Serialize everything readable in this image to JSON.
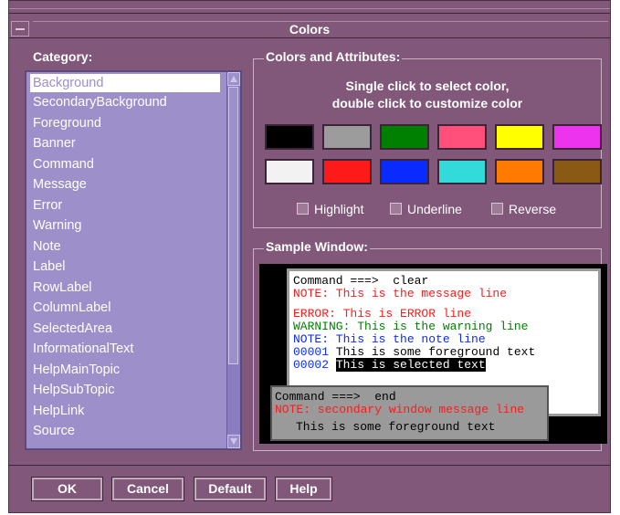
{
  "window": {
    "title": "Colors"
  },
  "category": {
    "label": "Category:",
    "items": [
      "Background",
      "SecondaryBackground",
      "Foreground",
      "Banner",
      "Command",
      "Message",
      "Error",
      "Warning",
      "Note",
      "Label",
      "RowLabel",
      "ColumnLabel",
      "SelectedArea",
      "InformationalText",
      "HelpMainTopic",
      "HelpSubTopic",
      "HelpLink",
      "Source"
    ],
    "selected": "Background"
  },
  "colors_group": {
    "label": "Colors and Attributes:",
    "hint_line1": "Single click to select color,",
    "hint_line2": "double click to customize color",
    "swatches": [
      {
        "name": "black",
        "hex": "#000000"
      },
      {
        "name": "gray",
        "hex": "#9c9c9c"
      },
      {
        "name": "green",
        "hex": "#008000"
      },
      {
        "name": "pink",
        "hex": "#ff4f7b"
      },
      {
        "name": "yellow",
        "hex": "#ffff00"
      },
      {
        "name": "magenta",
        "hex": "#ee33ee"
      },
      {
        "name": "white",
        "hex": "#f2f2f2"
      },
      {
        "name": "red",
        "hex": "#ff1a1a"
      },
      {
        "name": "blue",
        "hex": "#0a2bff"
      },
      {
        "name": "cyan",
        "hex": "#33dada"
      },
      {
        "name": "orange",
        "hex": "#ff7a00"
      },
      {
        "name": "brown",
        "hex": "#8a5a14"
      }
    ],
    "attributes": {
      "highlight": "Highlight",
      "underline": "Underline",
      "reverse": "Reverse"
    }
  },
  "sample": {
    "label": "Sample Window:",
    "command_prompt": "Command ===>",
    "command_value": "clear",
    "note_message": "NOTE: This is the message line",
    "error_line": "ERROR: This is ERROR line",
    "warning_line": "WARNING: This is the warning line",
    "note_line": "NOTE: This is the note line",
    "row1_num": "00001",
    "row1_text": "This is some foreground text",
    "row2_num": "00002",
    "row2_text": "This is selected text",
    "secondary": {
      "command_prompt": "Command ===>",
      "command_value": "end",
      "note": "NOTE: secondary window message line",
      "text": "This is some foreground text"
    }
  },
  "buttons": {
    "ok": "OK",
    "cancel": "Cancel",
    "default": "Default",
    "help": "Help"
  }
}
